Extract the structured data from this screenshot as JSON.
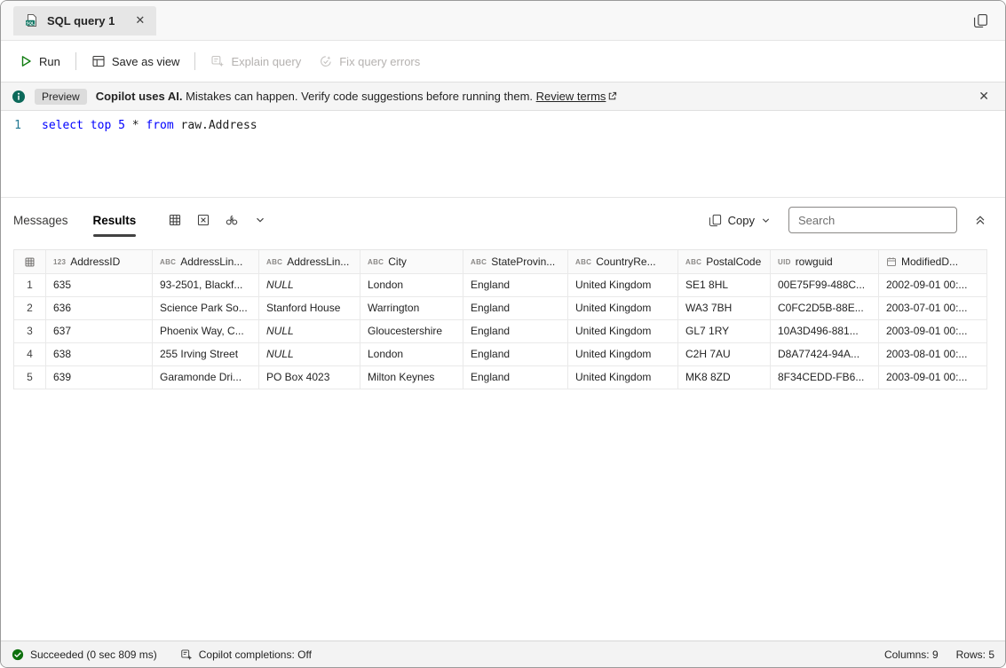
{
  "tab": {
    "title": "SQL query 1"
  },
  "toolbar": {
    "run": "Run",
    "save_as_view": "Save as view",
    "explain_query": "Explain query",
    "fix_query_errors": "Fix query errors"
  },
  "banner": {
    "badge": "Preview",
    "message_bold": "Copilot uses AI.",
    "message": "Mistakes can happen. Verify code suggestions before running them.",
    "link": "Review terms"
  },
  "editor": {
    "line_number": "1",
    "tokens": [
      {
        "text": "select top 5",
        "type": "keyword"
      },
      {
        "text": " * ",
        "type": "plain"
      },
      {
        "text": "from",
        "type": "keyword"
      },
      {
        "text": " raw.Address",
        "type": "plain"
      }
    ]
  },
  "results": {
    "tabs": {
      "messages": "Messages",
      "results": "Results"
    },
    "copy_label": "Copy",
    "search_placeholder": "Search",
    "columns": [
      {
        "icon": "123",
        "label": "AddressID"
      },
      {
        "icon": "ABC",
        "label": "AddressLin..."
      },
      {
        "icon": "ABC",
        "label": "AddressLin..."
      },
      {
        "icon": "ABC",
        "label": "City"
      },
      {
        "icon": "ABC",
        "label": "StateProvin..."
      },
      {
        "icon": "ABC",
        "label": "CountryRe..."
      },
      {
        "icon": "ABC",
        "label": "PostalCode"
      },
      {
        "icon": "UID",
        "label": "rowguid"
      },
      {
        "icon": "calendar",
        "label": "ModifiedD..."
      }
    ],
    "rows": [
      {
        "num": "1",
        "cells": [
          "635",
          "93-2501, Blackf...",
          "NULL",
          "London",
          "England",
          "United Kingdom",
          "SE1 8HL",
          "00E75F99-488C...",
          "2002-09-01 00:..."
        ]
      },
      {
        "num": "2",
        "cells": [
          "636",
          "Science Park So...",
          "Stanford House",
          "Warrington",
          "England",
          "United Kingdom",
          "WA3 7BH",
          "C0FC2D5B-88E...",
          "2003-07-01 00:..."
        ]
      },
      {
        "num": "3",
        "cells": [
          "637",
          "Phoenix Way, C...",
          "NULL",
          "Gloucestershire",
          "England",
          "United Kingdom",
          "GL7 1RY",
          "10A3D496-881...",
          "2003-09-01 00:..."
        ]
      },
      {
        "num": "4",
        "cells": [
          "638",
          "255 Irving Street",
          "NULL",
          "London",
          "England",
          "United Kingdom",
          "C2H 7AU",
          "D8A77424-94A...",
          "2003-08-01 00:..."
        ]
      },
      {
        "num": "5",
        "cells": [
          "639",
          "Garamonde Dri...",
          "PO Box 4023",
          "Milton Keynes",
          "England",
          "United Kingdom",
          "MK8 8ZD",
          "8F34CEDD-FB6...",
          "2003-09-01 00:..."
        ]
      }
    ]
  },
  "statusbar": {
    "status": "Succeeded (0 sec 809 ms)",
    "copilot": "Copilot completions: Off",
    "columns": "Columns: 9",
    "rows": "Rows: 5"
  },
  "icons": {
    "close": "✕"
  },
  "colors": {
    "run_green": "#107c10",
    "success_green": "#0e700e",
    "sql_icon_green": "#117865",
    "keyword_blue": "#0000ff"
  }
}
